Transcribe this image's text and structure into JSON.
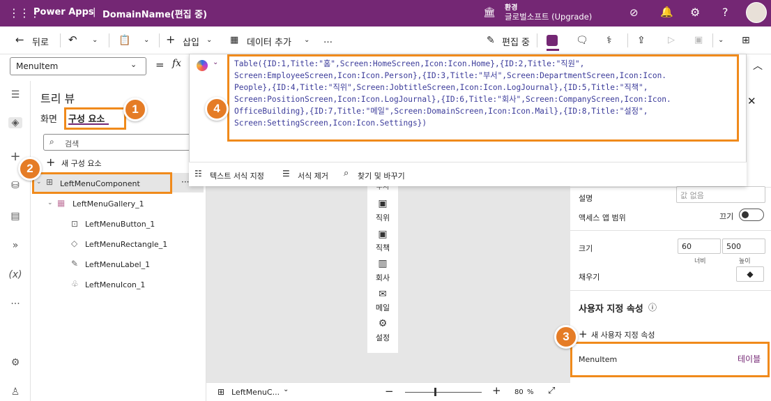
{
  "topbar": {
    "app_name": "Power Apps",
    "separator": "|",
    "app_title": "DomainName(편집 중)",
    "env_label": "환경",
    "env_name": "글로벌소프트 (Upgrade)"
  },
  "commandbar": {
    "back": "뒤로",
    "insert": "삽입",
    "add_data": "데이터 추가",
    "more": "…",
    "editing": "편집 중"
  },
  "formulabar": {
    "property": "MenuItem",
    "equals": "=",
    "fx": "fx",
    "formula": "Table({ID:1,Title:\"홈\",Screen:HomeScreen,Icon:Icon.Home},{ID:2,Title:\"직원\",\nScreen:EmployeeScreen,Icon:Icon.Person},{ID:3,Title:\"부서\",Screen:DepartmentScreen,Icon:Icon.\nPeople},{ID:4,Title:\"직위\",Screen:JobtitleScreen,Icon:Icon.LogJournal},{ID:5,Title:\"직책\",\nScreen:PositionScreen,Icon:Icon.LogJournal},{ID:6,Title:\"회사\",Screen:CompanyScreen,Icon:Icon.\nOfficeBuilding},{ID:7,Title:\"메일\",Screen:DomainScreen,Icon:Icon.Mail},{ID:8,Title:\"설정\",\nScreen:SettingScreen,Icon:Icon.Settings})",
    "format_text": "텍스트 서식 지정",
    "remove_format": "서식 제거",
    "find_replace": "찾기 및 바꾸기"
  },
  "tree": {
    "title": "트리 뷰",
    "tab_screens": "화면",
    "tab_components": "구성 요소",
    "search_placeholder": "검색",
    "new_component": "새 구성 요소",
    "items": [
      {
        "label": "LeftMenuComponent"
      },
      {
        "label": "LeftMenuGallery_1"
      },
      {
        "label": "LeftMenuButton_1"
      },
      {
        "label": "LeftMenuRectangle_1"
      },
      {
        "label": "LeftMenuLabel_1"
      },
      {
        "label": "LeftMenuIcon_1"
      }
    ]
  },
  "canvas_menu": {
    "items": [
      "직위",
      "직책",
      "회사",
      "메일",
      "설정"
    ],
    "partial_top": "부서"
  },
  "properties": {
    "description_label": "설명",
    "description_placeholder": "값 없음",
    "access_label": "액세스 앱 범위",
    "access_value": "끄기",
    "size_label": "크기",
    "width_value": "60",
    "height_value": "500",
    "width_caption": "너비",
    "height_caption": "높이",
    "fill_label": "채우기",
    "custom_props_title": "사용자 지정 속성",
    "new_custom_prop": "새 사용자 지정 속성",
    "custom_prop_name": "MenuItem",
    "custom_prop_type": "테이블"
  },
  "bottombar": {
    "component_name": "LeftMenuC...",
    "zoom": "80",
    "zoom_unit": "%"
  },
  "badges": [
    "1",
    "2",
    "3",
    "4"
  ],
  "colors": {
    "brand": "#742774",
    "highlight": "#f08a1b",
    "badge": "#e57c26",
    "link": "#742774"
  }
}
